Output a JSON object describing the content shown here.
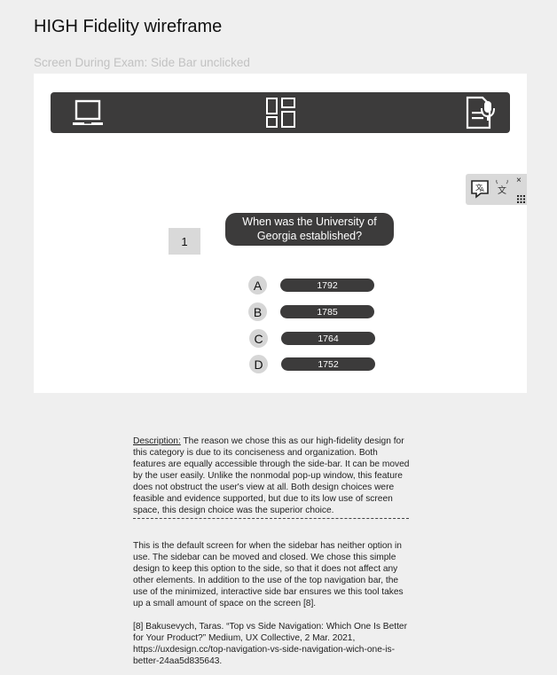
{
  "page": {
    "title": "HIGH Fidelity wireframe",
    "screen_caption": "Screen During Exam: Side Bar unclicked"
  },
  "topnav": {
    "icons": [
      "laptop-icon",
      "grid-icon",
      "voice-input-icon"
    ]
  },
  "sidebar": {
    "icons": [
      "translate-icon",
      "text-to-speech-icon",
      "close-icon",
      "keypad-icon"
    ],
    "close_glyph": "×"
  },
  "question": {
    "number": "1",
    "text": "When was the University of Georgia established?",
    "options": [
      {
        "letter": "A",
        "value": "1792"
      },
      {
        "letter": "B",
        "value": "1785"
      },
      {
        "letter": "C",
        "value": "1764"
      },
      {
        "letter": "D",
        "value": "1752"
      }
    ]
  },
  "description": {
    "label": "Description:",
    "text": " The reason we chose this as our high-fidelity design for this category is due to its conciseness and organization. Both features are equally accessible through the side-bar. It can be moved by the user easily. Unlike the nonmodal pop-up window, this feature does not obstruct the user's view at all. Both design choices were feasible and evidence supported, but due to its low use of screen space, this design choice was the superior choice."
  },
  "explanation": "This is the default screen for when the sidebar has neither option in use. The sidebar can be moved and closed. We chose this simple design to keep this option to the side, so that it does not affect any other elements. In addition to the use of the top navigation bar, the use of the minimized, interactive side bar ensures we this tool takes up a small amount of space on the screen [8].",
  "citation": "[8] Bakusevych, Taras. “Top vs Side Navigation: Which One Is Better for Your Product?” Medium, UX Collective, 2 Mar. 2021, https://uxdesign.cc/top-navigation-vs-side-navigation-wich-one-is-better-24aa5d835643.",
  "colors": {
    "dark": "#3c3b3b",
    "light_gray": "#d9d9d9",
    "background": "#efefef"
  }
}
